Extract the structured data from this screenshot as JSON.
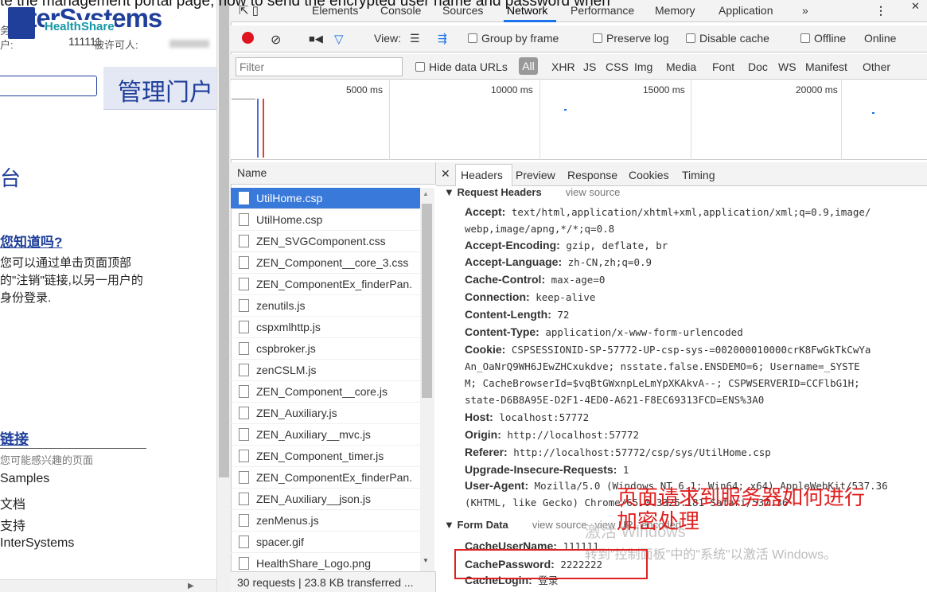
{
  "question_overlay": "te the management portal page, how to send the encrypted user name and password when",
  "portal": {
    "logo_text": "InterSystems",
    "logo_sub": "HealthShare",
    "server_label": "务器",
    "user_label": "户:",
    "user_value": "111111",
    "license_label": "被许可人:",
    "title": "管理门户",
    "heading": "台",
    "did_you_know": "您知道吗?",
    "tip": "您可以通过单击页面顶部\n的\"注销\"链接,以另一用户的\n身份登录.",
    "links_heading": "链接",
    "links_sub": "您可能感兴趣的页面",
    "links": [
      "Samples",
      "文档",
      "支持",
      "InterSystems"
    ]
  },
  "devtools": {
    "tabs": [
      "Elements",
      "Console",
      "Sources",
      "Network",
      "Performance",
      "Memory",
      "Application",
      "»"
    ],
    "active_tab": "Network",
    "toolbar": {
      "view_label": "View:",
      "group_by_frame": "Group by frame",
      "preserve_log": "Preserve log",
      "disable_cache": "Disable cache",
      "offline": "Offline",
      "online": "Online"
    },
    "filter_placeholder": "Filter",
    "hide_data_urls": "Hide data URLs",
    "types": [
      "All",
      "XHR",
      "JS",
      "CSS",
      "Img",
      "Media",
      "Font",
      "Doc",
      "WS",
      "Manifest",
      "Other"
    ],
    "timeline_labels": [
      "5000 ms",
      "10000 ms",
      "15000 ms",
      "20000 ms"
    ],
    "name_header": "Name",
    "requests": [
      "UtilHome.csp",
      "UtilHome.csp",
      "ZEN_SVGComponent.css",
      "ZEN_Component__core_3.css",
      "ZEN_ComponentEx_finderPan.",
      "zenutils.js",
      "cspxmlhttp.js",
      "cspbroker.js",
      "zenCSLM.js",
      "ZEN_Component__core.js",
      "ZEN_Auxiliary.js",
      "ZEN_Auxiliary__mvc.js",
      "ZEN_Component_timer.js",
      "ZEN_ComponentEx_finderPan.",
      "ZEN_Auxiliary__json.js",
      "zenMenus.js",
      "spacer.gif",
      "HealthShare_Logo.png"
    ],
    "status": "30 requests | 23.8 KB transferred ...",
    "detail_tabs": [
      "Headers",
      "Preview",
      "Response",
      "Cookies",
      "Timing"
    ],
    "request_headers_title": "Request Headers",
    "view_source": "view source",
    "headers": [
      {
        "k": "Accept:",
        "v": "text/html,application/xhtml+xml,application/xml;q=0.9,image/\nwebp,image/apng,*/*;q=0.8"
      },
      {
        "k": "Accept-Encoding:",
        "v": "gzip, deflate, br"
      },
      {
        "k": "Accept-Language:",
        "v": "zh-CN,zh;q=0.9"
      },
      {
        "k": "Cache-Control:",
        "v": "max-age=0"
      },
      {
        "k": "Connection:",
        "v": "keep-alive"
      },
      {
        "k": "Content-Length:",
        "v": "72"
      },
      {
        "k": "Content-Type:",
        "v": "application/x-www-form-urlencoded"
      },
      {
        "k": "Cookie:",
        "v": "CSPSESSIONID-SP-57772-UP-csp-sys-=002000010000crK8FwGkTkCwYa\nAn_OaNrQ9WH6JEwZHCxukdve; nsstate.false.ENSDEMO=6; Username=_SYSTE\nM; CacheBrowserId=$vqBtGWxnpLeLmYpXKAkvA--; CSPWSERVERID=CCFlbG1H;\nstate-D6B8A95E-D2F1-4ED0-A621-F8EC69313FCD=ENS%3A0"
      },
      {
        "k": "Host:",
        "v": "localhost:57772"
      },
      {
        "k": "Origin:",
        "v": "http://localhost:57772"
      },
      {
        "k": "Referer:",
        "v": "http://localhost:57772/csp/sys/UtilHome.csp"
      },
      {
        "k": "Upgrade-Insecure-Requests:",
        "v": "1"
      },
      {
        "k": "User-Agent:",
        "v": "Mozilla/5.0 (Windows NT 6.1; Win64; x64) AppleWebKit/537.36\n(KHTML, like Gecko) Chrome/65.0.3325.181 Safari/537.36"
      }
    ],
    "form_data_title": "Form Data",
    "view_url_encoded": "view URL encoded",
    "form_data": [
      {
        "k": "CacheUserName:",
        "v": "111111"
      },
      {
        "k": "CachePassword:",
        "v": "2222222"
      },
      {
        "k": "CacheLogin:",
        "v": "登录"
      }
    ]
  },
  "annotation": "页面请求到服务器如何进行\n加密处理",
  "watermark": {
    "line1": "激活 Windows",
    "line2": "转到\"控制面板\"中的\"系统\"以激活 Windows。"
  },
  "colors": {
    "accent": "#1a73e8",
    "record": "#e0141e",
    "annotation": "#e02020",
    "brand": "#1f3f9a",
    "selected_row": "#3879d9"
  }
}
